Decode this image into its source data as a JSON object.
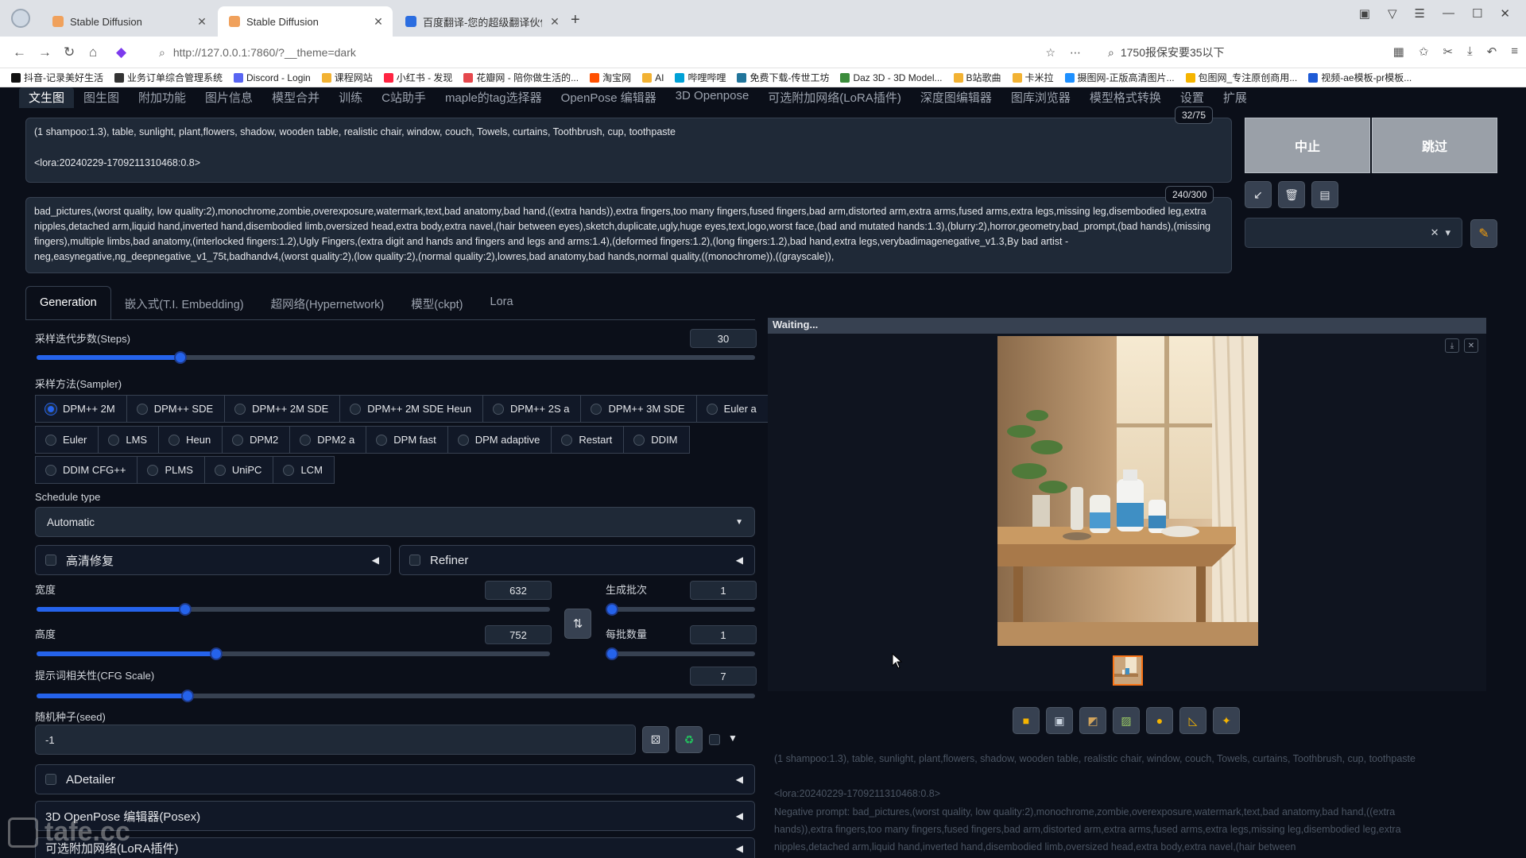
{
  "browser": {
    "tabs": [
      {
        "title": "Stable Diffusion",
        "active": false
      },
      {
        "title": "Stable Diffusion",
        "active": true
      },
      {
        "title": "百度翻译-您的超级翻译伙伴",
        "active": false
      }
    ],
    "url": "http://127.0.0.1:7860/?__theme=dark",
    "search_text": "1750报保安要35以下",
    "bookmarks": [
      "抖音-记录美好生活",
      "业务订单综合管理系统",
      "Discord - Login",
      "课程网站",
      "小红书 - 发现",
      "花瓣网 - 陪你做生活的...",
      "淘宝网",
      "AI",
      "哔哩哔哩",
      "免费下载-传世工坊",
      "Daz 3D - 3D Model...",
      "B站歌曲",
      "卡米拉",
      "摄图网-正版高清图片...",
      "包图网_专注原创商用...",
      "视频-ae模板-pr模板..."
    ]
  },
  "app": {
    "nav_tabs": [
      "文生图",
      "图生图",
      "附加功能",
      "图片信息",
      "模型合并",
      "训练",
      "C站助手",
      "maple的tag选择器",
      "OpenPose 编辑器",
      "3D Openpose",
      "可选附加网络(LoRA插件)",
      "深度图编辑器",
      "图库浏览器",
      "模型格式转换",
      "设置",
      "扩展"
    ],
    "prompt": {
      "line1": "(1 shampoo:1.3), table, sunlight, plant,flowers,  shadow, wooden table, realistic chair, window, couch, Towels, curtains, Toothbrush, cup, toothpaste",
      "line2": "<lora:20240229-1709211310468:0.8>",
      "token_count": "32/75"
    },
    "negative_prompt": {
      "text": "bad_pictures,(worst quality, low quality:2),monochrome,zombie,overexposure,watermark,text,bad anatomy,bad hand,((extra hands)),extra fingers,too many fingers,fused fingers,bad arm,distorted arm,extra arms,fused arms,extra legs,missing leg,disembodied leg,extra nipples,detached arm,liquid hand,inverted hand,disembodied limb,oversized head,extra body,extra navel,(hair between eyes),sketch,duplicate,ugly,huge eyes,text,logo,worst face,(bad and mutated hands:1.3),(blurry:2),horror,geometry,bad_prompt,(bad hands),(missing fingers),multiple limbs,bad anatomy,(interlocked fingers:1.2),Ugly Fingers,(extra digit and hands and fingers and legs and arms:1.4),(deformed fingers:1.2),(long fingers:1.2),bad hand,extra legs,verybadimagenegative_v1.3,By bad artist -neg,easynegative,ng_deepnegative_v1_75t,badhandv4,(worst quality:2),(low quality:2),(normal quality:2),lowres,bad anatomy,bad hands,normal quality,((monochrome)),((grayscale)),",
      "token_count": "240/300"
    },
    "buttons": {
      "interrupt": "中止",
      "skip": "跳过"
    },
    "sub_tabs": [
      "Generation",
      "嵌入式(T.I. Embedding)",
      "超网络(Hypernetwork)",
      "模型(ckpt)",
      "Lora"
    ],
    "steps": {
      "label": "采样迭代步数(Steps)",
      "value": "30",
      "fraction": 0.2
    },
    "sampler": {
      "label": "采样方法(Sampler)",
      "row1": [
        "DPM++ 2M",
        "DPM++ SDE",
        "DPM++ 2M SDE",
        "DPM++ 2M SDE Heun",
        "DPM++ 2S a",
        "DPM++ 3M SDE",
        "Euler a"
      ],
      "row2": [
        "Euler",
        "LMS",
        "Heun",
        "DPM2",
        "DPM2 a",
        "DPM fast",
        "DPM adaptive",
        "Restart",
        "DDIM"
      ],
      "row3": [
        "DDIM CFG++",
        "PLMS",
        "UniPC",
        "LCM"
      ],
      "selected": "DPM++ 2M"
    },
    "schedule": {
      "label": "Schedule type",
      "value": "Automatic"
    },
    "hires_fix": "高清修复",
    "refiner": "Refiner",
    "width": {
      "label": "宽度",
      "value": "632",
      "fraction": 0.29
    },
    "height": {
      "label": "高度",
      "value": "752",
      "fraction": 0.35
    },
    "batch_count": {
      "label": "生成批次",
      "value": "1",
      "fraction": 0.0
    },
    "batch_size": {
      "label": "每批数量",
      "value": "1",
      "fraction": 0.0
    },
    "cfg": {
      "label": "提示词相关性(CFG Scale)",
      "value": "7",
      "fraction": 0.21
    },
    "seed": {
      "label": "随机种子(seed)",
      "value": "-1"
    },
    "accordions": [
      "ADetailer",
      "3D OpenPose 编辑器(Posex)",
      "可选附加网络(LoRA插件)"
    ],
    "output": {
      "status": "Waiting...",
      "info_line1": "(1 shampoo:1.3), table, sunlight, plant,flowers,  shadow, wooden table, realistic chair, window, couch, Towels, curtains, Toothbrush, cup, toothpaste",
      "info_line2": "<lora:20240229-1709211310468:0.8>",
      "info_line3": "Negative prompt: bad_pictures,(worst quality, low quality:2),monochrome,zombie,overexposure,watermark,text,bad anatomy,bad hand,((extra",
      "info_line4": "hands)),extra fingers,too many fingers,fused fingers,bad arm,distorted arm,extra arms,fused arms,extra legs,missing leg,disembodied leg,extra",
      "info_line5": "nipples,detached arm,liquid hand,inverted hand,disembodied limb,oversized head,extra body,extra navel,(hair between"
    },
    "watermark": "tafe.cc"
  },
  "colors": {
    "accent": "#2563eb",
    "background": "#0b0f19",
    "panel": "#1f2937",
    "thumb_border": "#f97316"
  }
}
